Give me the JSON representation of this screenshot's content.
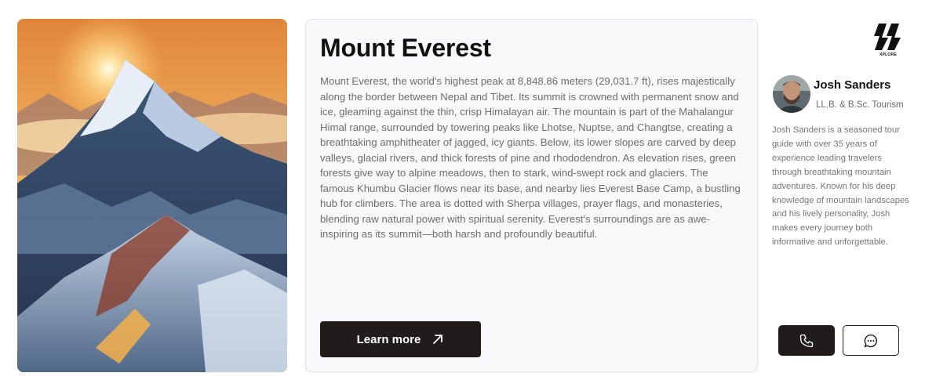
{
  "image": {
    "alt": "Mount Everest at sunrise"
  },
  "main": {
    "title": "Mount Everest",
    "description": "Mount Everest, the world's highest peak at 8,848.86 meters (29,031.7 ft), rises majestically along the border between Nepal and Tibet. Its summit is crowned with permanent snow and ice, gleaming against the thin, crisp Himalayan air. The mountain is part of the Mahalangur Himal range, surrounded by towering peaks like Lhotse, Nuptse, and Changtse, creating a breathtaking amphitheater of jagged, icy giants. Below, its lower slopes are carved by deep valleys, glacial rivers, and thick forests of pine and rhododendron. As elevation rises, green forests give way to alpine meadows, then to stark, wind-swept rock and glaciers. The famous Khumbu Glacier flows near its base, and nearby lies Everest Base Camp, a bustling hub for climbers. The area is dotted with Sherpa villages, prayer flags, and monasteries, blending raw natural power with spiritual serenity. Everest's surroundings are as awe-inspiring as its summit—both harsh and profoundly beautiful.",
    "learn_more_label": "Learn more",
    "learn_more_icon": "arrow-up-right-icon"
  },
  "brand": {
    "logo_text": "XPLORE"
  },
  "guide": {
    "name": "Josh Sanders",
    "degree": "LL.B. & B.Sc. Tourism",
    "bio": "Josh Sanders is a seasoned tour guide with over 35 years of experience leading travelers through breathtaking mountain adventures. Known for his deep knowledge of mountain landscapes and his lively personality, Josh makes every journey both informative and unforgettable.",
    "call_icon": "phone-icon",
    "message_icon": "chat-bubble-icon"
  },
  "colors": {
    "dark_button": "#201c1c",
    "card_background": "#f8f8fa",
    "body_text": "#6e6e72"
  }
}
